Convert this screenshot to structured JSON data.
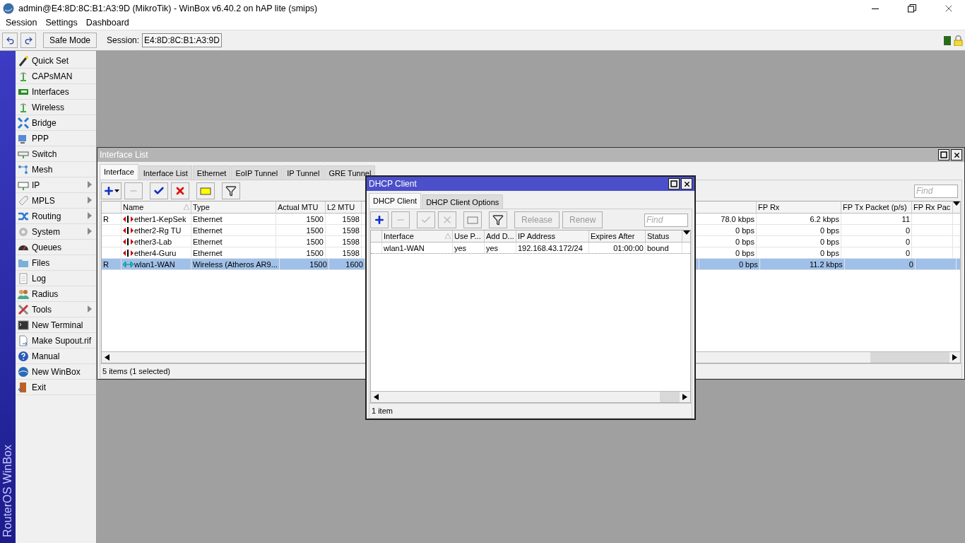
{
  "window": {
    "title": "admin@E4:8D:8C:B1:A3:9D (MikroTik) - WinBox v6.40.2 on hAP lite (smips)"
  },
  "menu": [
    "Session",
    "Settings",
    "Dashboard"
  ],
  "toolbar": {
    "safe_mode": "Safe Mode",
    "session_label": "Session:",
    "session_value": "E4:8D:8C:B1:A3:9D"
  },
  "sidebar": {
    "brand": "RouterOS WinBox",
    "items": [
      {
        "label": "Quick Set",
        "submenu": false
      },
      {
        "label": "CAPsMAN",
        "submenu": false
      },
      {
        "label": "Interfaces",
        "submenu": false
      },
      {
        "label": "Wireless",
        "submenu": false
      },
      {
        "label": "Bridge",
        "submenu": false
      },
      {
        "label": "PPP",
        "submenu": false
      },
      {
        "label": "Switch",
        "submenu": false
      },
      {
        "label": "Mesh",
        "submenu": false
      },
      {
        "label": "IP",
        "submenu": true
      },
      {
        "label": "MPLS",
        "submenu": true
      },
      {
        "label": "Routing",
        "submenu": true
      },
      {
        "label": "System",
        "submenu": true
      },
      {
        "label": "Queues",
        "submenu": false
      },
      {
        "label": "Files",
        "submenu": false
      },
      {
        "label": "Log",
        "submenu": false
      },
      {
        "label": "Radius",
        "submenu": false
      },
      {
        "label": "Tools",
        "submenu": true
      },
      {
        "label": "New Terminal",
        "submenu": false
      },
      {
        "label": "Make Supout.rif",
        "submenu": false
      },
      {
        "label": "Manual",
        "submenu": false
      },
      {
        "label": "New WinBox",
        "submenu": false
      },
      {
        "label": "Exit",
        "submenu": false
      }
    ]
  },
  "interface_list": {
    "title": "Interface List",
    "tabs": [
      {
        "label": "Interface",
        "selected": true
      },
      {
        "label": "Interface List",
        "selected": false
      },
      {
        "label": "Ethernet",
        "selected": false
      },
      {
        "label": "EoIP Tunnel",
        "selected": false
      },
      {
        "label": "IP Tunnel",
        "selected": false
      },
      {
        "label": "GRE Tunnel",
        "selected": false
      }
    ],
    "find_placeholder": "Find",
    "columns": [
      {
        "label": "Name",
        "sorted": true
      },
      {
        "label": "Type",
        "sorted": false
      },
      {
        "label": "Actual MTU",
        "sorted": false
      },
      {
        "label": "L2 MTU",
        "sorted": false
      },
      {
        "label": "FP Rx",
        "sorted": false
      },
      {
        "label": "FP Tx Packet (p/s)",
        "sorted": false
      },
      {
        "label": "FP Rx Pac",
        "sorted": false
      }
    ],
    "rows": [
      {
        "flag": "R",
        "kind": "ethernet",
        "name": "ether1-KepSek",
        "type": "Ethernet",
        "mtu": "1500",
        "l2mtu": "1598",
        "column_7": "78.0 kbps",
        "fp_rx": "6.2 kbps",
        "fp_tx_packet": "11",
        "selected": false
      },
      {
        "kind": "ethernet",
        "name": "ether2-Rg TU",
        "type": "Ethernet",
        "mtu": "1500",
        "l2mtu": "1598",
        "column_7": "0 bps",
        "fp_rx": "0 bps",
        "fp_tx_packet": "0",
        "selected": false
      },
      {
        "kind": "ethernet",
        "name": "ether3-Lab",
        "type": "Ethernet",
        "mtu": "1500",
        "l2mtu": "1598",
        "column_7": "0 bps",
        "fp_rx": "0 bps",
        "fp_tx_packet": "0",
        "selected": false
      },
      {
        "kind": "ethernet",
        "name": "ether4-Guru",
        "type": "Ethernet",
        "mtu": "1500",
        "l2mtu": "1598",
        "column_7": "0 bps",
        "fp_rx": "0 bps",
        "fp_tx_packet": "0",
        "selected": false
      },
      {
        "flag": "R",
        "kind": "wireless",
        "name": "wlan1-WAN",
        "type": "Wireless (Atheros AR9...",
        "mtu": "1500",
        "l2mtu": "1600",
        "column_7": "0 bps",
        "fp_rx": "11.2 kbps",
        "fp_tx_packet": "0",
        "selected": true
      }
    ],
    "status": "5 items (1 selected)"
  },
  "dhcp_client": {
    "title": "DHCP Client",
    "tabs": [
      {
        "label": "DHCP Client",
        "selected": true
      },
      {
        "label": "DHCP Client Options",
        "selected": false
      }
    ],
    "buttons": [
      {
        "label": "Release",
        "disabled": true
      },
      {
        "label": "Renew",
        "disabled": true
      }
    ],
    "find_placeholder": "Find",
    "columns": [
      {
        "label": "Interface",
        "sorted": true
      },
      {
        "label": "Use P...",
        "sorted": false
      },
      {
        "label": "Add D...",
        "sorted": false
      },
      {
        "label": "IP Address",
        "sorted": false
      },
      {
        "label": "Expires After",
        "sorted": false
      },
      {
        "label": "Status",
        "sorted": false
      }
    ],
    "rows": [
      {
        "interface": "wlan1-WAN",
        "use_peer": "yes",
        "add_default": "yes",
        "ip_address": "192.168.43.172/24",
        "expires_after": "01:00:00",
        "status": "bound",
        "selected": false
      }
    ],
    "status": "1 item"
  }
}
